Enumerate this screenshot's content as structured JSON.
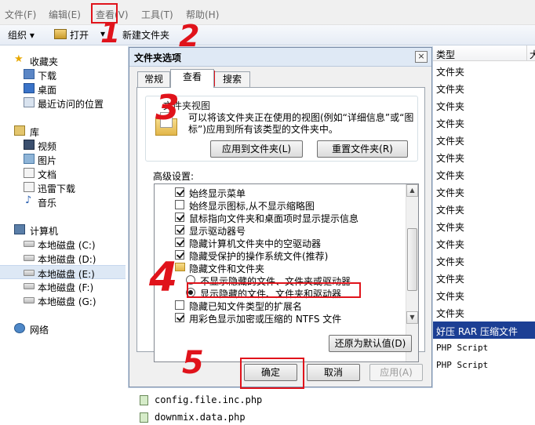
{
  "menubar": {
    "items": [
      "文件(F)",
      "编辑(E)",
      "查看(V)",
      "工具(T)",
      "帮助(H)"
    ]
  },
  "toolbar": {
    "organize": "组织 ▾",
    "open": "打开",
    "open_dropdown": "▾",
    "new_folder": "新建文件夹"
  },
  "nav": {
    "favorites": "收藏夹",
    "fav_items": [
      "下载",
      "桌面",
      "最近访问的位置"
    ],
    "libraries": "库",
    "lib_items": [
      "视频",
      "图片",
      "文档",
      "迅雷下载",
      "音乐"
    ],
    "computer": "计算机",
    "drives": [
      "本地磁盘 (C:)",
      "本地磁盘 (D:)",
      "本地磁盘 (E:)",
      "本地磁盘 (F:)",
      "本地磁盘 (G:)"
    ],
    "network": "网络"
  },
  "file_list": {
    "column_type": "类型",
    "column_size": "大",
    "types": [
      "文件夹",
      "文件夹",
      "文件夹",
      "文件夹",
      "文件夹",
      "文件夹",
      "文件夹",
      "文件夹",
      "文件夹",
      "文件夹",
      "文件夹",
      "文件夹",
      "文件夹",
      "文件夹",
      "文件夹"
    ],
    "rar_type": "好压 RAR 压缩文件",
    "php_types": [
      "PHP Script",
      "PHP Script"
    ],
    "files": [
      "config.file.inc.php",
      "downmix.data.php"
    ]
  },
  "dialog": {
    "title": "文件夹选项",
    "close": "×",
    "tabs": [
      "常规",
      "查看",
      "搜索"
    ],
    "folder_view_legend": "文件夹视图",
    "folder_view_desc": "可以将该文件夹正在使用的视图(例如“详细信息”或“图标”)应用到所有该类型的文件夹中。",
    "apply_to_folders": "应用到文件夹(L)",
    "reset_folders": "重置文件夹(R)",
    "advanced_label": "高级设置:",
    "settings": [
      {
        "label": "始终显示菜单",
        "checked": true
      },
      {
        "label": "始终显示图标,从不显示缩略图",
        "checked": false
      },
      {
        "label": "鼠标指向文件夹和桌面项时显示提示信息",
        "checked": true
      },
      {
        "label": "显示驱动器号",
        "checked": true
      },
      {
        "label": "隐藏计算机文件夹中的空驱动器",
        "checked": true
      },
      {
        "label": "隐藏受保护的操作系统文件(推荐)",
        "checked": true
      }
    ],
    "hidden_group": "隐藏文件和文件夹",
    "radio_dont_show": "不显示隐藏的文件、文件夹或驱动器",
    "radio_show": "显示隐藏的文件、文件夹和驱动器",
    "settings_after": [
      {
        "label": "隐藏已知文件类型的扩展名",
        "checked": false
      },
      {
        "label": "用彩色显示加密或压缩的 NTFS 文件",
        "checked": true
      }
    ],
    "restore_defaults": "还原为默认值(D)",
    "ok": "确定",
    "cancel": "取消",
    "apply": "应用(A)"
  },
  "annotations": {
    "step1": "1",
    "step2": "2",
    "step3": "3",
    "step4": "4",
    "step5": "5"
  },
  "colors": {
    "annotation_red": "#e0131b",
    "selection_blue": "#1c3f94"
  }
}
